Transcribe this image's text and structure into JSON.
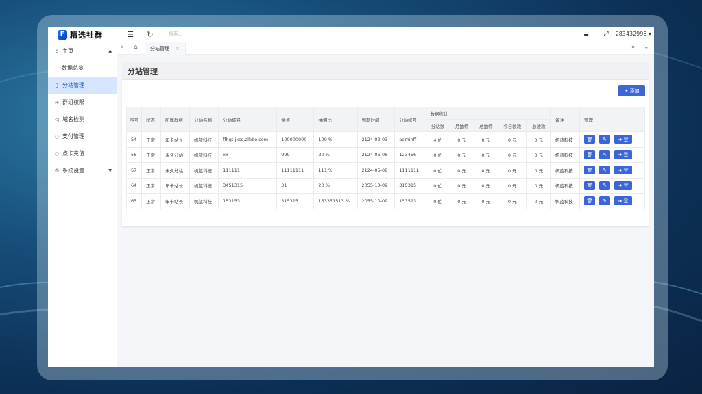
{
  "app": {
    "logo_text": "精选社群",
    "logo_mark": "F"
  },
  "header": {
    "search_placeholder": "搜索...",
    "username": "283432998 ▾"
  },
  "icons": {
    "menu": "☰",
    "refresh": "↻",
    "chat": "▬",
    "fullscreen": "⤢"
  },
  "tabbar": {
    "left_icon": "«",
    "home_icon": "⌂",
    "tab_label": "分站管理",
    "tab_close": "×",
    "right_icon": "»",
    "down_icon": "⌄"
  },
  "sidebar": {
    "items": [
      {
        "icon": "⌂",
        "label": "主页",
        "arrow": "▲"
      },
      {
        "icon": "",
        "label": "数据总览"
      },
      {
        "icon": "▯",
        "label": "分站管理"
      },
      {
        "icon": "≋",
        "label": "群组权限"
      },
      {
        "icon": "◁",
        "label": "域名检测"
      },
      {
        "icon": "◌",
        "label": "支付管理"
      },
      {
        "icon": "◌",
        "label": "点卡充值"
      },
      {
        "icon": "⚙",
        "label": "系统设置",
        "arrow": "▼"
      }
    ]
  },
  "page": {
    "title": "分站管理",
    "add_button": "+ 添加"
  },
  "table": {
    "headers": {
      "seq": "序号",
      "status": "状态",
      "group": "所属群组",
      "name": "分站名称",
      "domain": "分站域名",
      "remaining": "余点",
      "ratio": "抽佣比",
      "expire": "到期时间",
      "account": "分站帐号",
      "stats": "数据统计",
      "note": "备注",
      "manage": "管理"
    },
    "sub_headers": [
      "分站数",
      "月抽佣",
      "总抽佣",
      "今日收款",
      "总收款"
    ],
    "rows": [
      {
        "seq": "54",
        "status": "正常",
        "group": "年卡站长",
        "name": "帆蓝科技",
        "domain": "ffhgt.jxsq.zlbbo.com",
        "remaining": "100000000",
        "ratio": "100 %",
        "expire": "2124-02-03",
        "account": "adminff",
        "sites": "4 位",
        "month": "0 元",
        "total": "0 元",
        "today": "0 元",
        "income": "0 元",
        "note": "帆蓝科技"
      },
      {
        "seq": "56",
        "status": "正常",
        "group": "永久分站",
        "name": "帆蓝科技",
        "domain": "xx",
        "remaining": "999",
        "ratio": "20 %",
        "expire": "2124-05-08",
        "account": "123456",
        "sites": "0 位",
        "month": "0 元",
        "total": "0 元",
        "today": "0 元",
        "income": "0 元",
        "note": "帆蓝科技"
      },
      {
        "seq": "57",
        "status": "正常",
        "group": "永久分站",
        "name": "帆蓝科技",
        "domain": "111111",
        "remaining": "11111111",
        "ratio": "111 %",
        "expire": "2124-05-08",
        "account": "1111111",
        "sites": "0 位",
        "month": "0 元",
        "total": "0 元",
        "today": "0 元",
        "income": "0 元",
        "note": "帆蓝科技"
      },
      {
        "seq": "64",
        "status": "正常",
        "group": "年卡站长",
        "name": "帆蓝科技",
        "domain": "3451315",
        "remaining": "31",
        "ratio": "20 %",
        "expire": "2055-10-09",
        "account": "315315",
        "sites": "0 位",
        "month": "0 元",
        "total": "0 元",
        "today": "0 元",
        "income": "0 元",
        "note": "帆蓝科技"
      },
      {
        "seq": "65",
        "status": "正常",
        "group": "年卡站长",
        "name": "帆蓝科技",
        "domain": "153153",
        "remaining": "315315",
        "ratio": "153351513 %",
        "expire": "2055-10-09",
        "account": "153513",
        "sites": "0 位",
        "month": "0 元",
        "total": "0 元",
        "today": "0 元",
        "income": "0 元",
        "note": "帆蓝科技"
      }
    ],
    "actions": {
      "delete_icon": "🗑",
      "edit_icon": "✎",
      "login_label": "➜ 登"
    }
  }
}
